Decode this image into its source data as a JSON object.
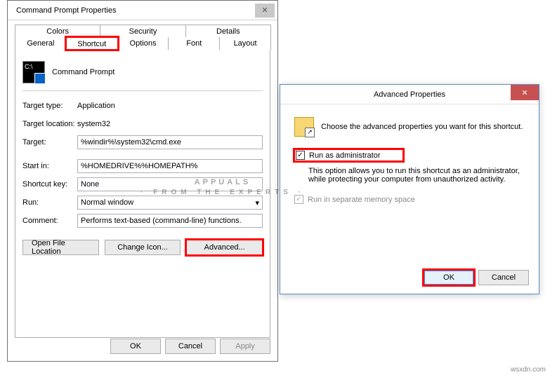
{
  "props": {
    "title": "Command Prompt Properties",
    "tabs_top": [
      "Colors",
      "Security",
      "Details"
    ],
    "tabs_bottom": [
      "General",
      "Shortcut",
      "Options",
      "Font",
      "Layout"
    ],
    "app_name": "Command Prompt",
    "target_type_lbl": "Target type:",
    "target_type_val": "Application",
    "target_loc_lbl": "Target location:",
    "target_loc_val": "system32",
    "target_lbl": "Target:",
    "target_val": "%windir%\\system32\\cmd.exe",
    "start_in_lbl": "Start in:",
    "start_in_val": "%HOMEDRIVE%%HOMEPATH%",
    "shortcut_key_lbl": "Shortcut key:",
    "shortcut_key_val": "None",
    "run_lbl": "Run:",
    "run_val": "Normal window",
    "comment_lbl": "Comment:",
    "comment_val": "Performs text-based (command-line) functions.",
    "btn_open_loc": "Open File Location",
    "btn_change_icon": "Change Icon...",
    "btn_advanced": "Advanced...",
    "btn_ok": "OK",
    "btn_cancel": "Cancel",
    "btn_apply": "Apply"
  },
  "adv": {
    "title": "Advanced Properties",
    "intro": "Choose the advanced properties you want for this shortcut.",
    "run_admin": "Run as administrator",
    "run_admin_desc": "This option allows you to run this shortcut as an administrator, while protecting your computer from unauthorized activity.",
    "sep_mem": "Run in separate memory space",
    "btn_ok": "OK",
    "btn_cancel": "Cancel"
  },
  "watermark": {
    "main": "APPUALS",
    "sub": "· FROM  THE  EXPERTS ·"
  },
  "credit": "wsxdn.com"
}
